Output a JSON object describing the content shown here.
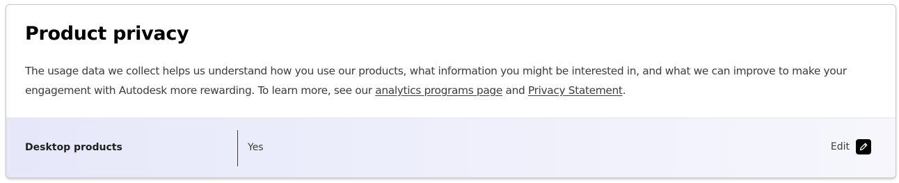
{
  "section": {
    "title": "Product privacy",
    "description_before": "The usage data we collect helps us understand how you use our products, what information you might be interested in, and what we can improve to make your engagement with Autodesk more rewarding. To learn more, see our ",
    "analytics_link": "analytics programs page",
    "description_middle": " and ",
    "privacy_link": "Privacy Statement",
    "description_after": "."
  },
  "setting": {
    "label": "Desktop products",
    "value": "Yes",
    "edit_label": "Edit"
  },
  "icons": {
    "edit": "pencil-icon"
  },
  "colors": {
    "row_background_start": "#e6e8fa",
    "row_background_end": "#f6f6fc",
    "edit_icon_background": "#000000"
  }
}
